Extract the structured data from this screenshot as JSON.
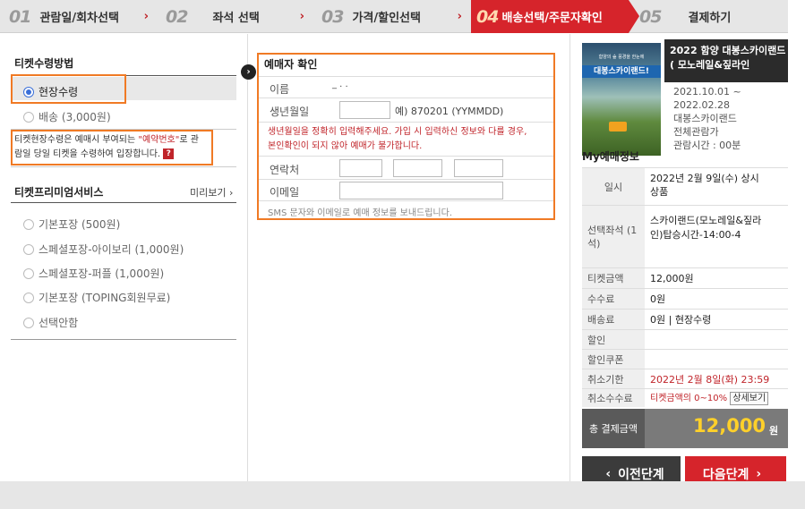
{
  "steps": [
    {
      "num": "01",
      "label": "관람일/회차선택",
      "arrow": "›"
    },
    {
      "num": "02",
      "label": "좌석 선택",
      "arrow": "›"
    },
    {
      "num": "03",
      "label": "가격/할인선택",
      "arrow": "›"
    },
    {
      "num": "04",
      "label": "배송선택/주문자확인",
      "arrow": "›"
    },
    {
      "num": "05",
      "label": "결제하기",
      "arrow": ""
    }
  ],
  "ticket_method": {
    "title": "티켓수령방법",
    "options": [
      {
        "label": "현장수령",
        "selected": true
      },
      {
        "label": "배송 (3,000원)",
        "selected": false
      }
    ],
    "notice_pre": "티켓현장수령은 예매시 부여되는 ",
    "notice_red": "\"예약번호\"",
    "notice_post": "로 관람일 당일 티켓을 수령하여 입장합니다.",
    "help_icon": "?"
  },
  "premium": {
    "title": "티켓프리미엄서비스",
    "preview": "미리보기 ›",
    "options": [
      "기본포장 (500원)",
      "스페셜포장-아이보리 (1,000원)",
      "스페셜포장-퍼플 (1,000원)",
      "기본포장 (TOPING회원무료)",
      "선택안함"
    ]
  },
  "booker": {
    "title": "예매자 확인",
    "name_label": "이름",
    "name_value": "_ . .",
    "birth_label": "생년월일",
    "birth_hint": "예) 870201 (YYMMDD)",
    "warning_line1": "생년월일을 정확히 입력해주세요. 가입 시 입력하신 정보와 다를 경우,",
    "warning_line2": "본인확인이 되지 않아 예매가 불가합니다.",
    "phone_label": "연락처",
    "email_label": "이메일",
    "sms_note": "SMS 문자와 이메일로 예매 정보를 보내드립니다."
  },
  "product": {
    "title": "2022 함양 대봉스카이랜드 ( 모노레일&짚라인",
    "poster_title": "대봉스카이랜드!",
    "poster_sub": "함양의 숲 풍경을 한눈에",
    "period_start": "2021.10.01 ~",
    "period_end": "2022.02.28",
    "venue": "대봉스카이랜드",
    "rating": "전체관람가",
    "runtime": "관람시간 : 00분"
  },
  "my_booking": {
    "title": "My예매정보",
    "rows": [
      {
        "key": "일시",
        "value1": "2022년 2월 9일(수) 상시",
        "value2": "상품"
      },
      {
        "key": "선택좌석 (1석)",
        "value1": "스카이랜드(모노레일&짚라",
        "value2": "인)탑승시간-14:00-4"
      },
      {
        "key": "티켓금액",
        "value1": "12,000원"
      },
      {
        "key": "수수료",
        "value1": "0원"
      },
      {
        "key": "배송료",
        "value1": "0원 | 현장수령"
      },
      {
        "key": "할인",
        "value1": ""
      },
      {
        "key": "할인쿠폰",
        "value1": ""
      },
      {
        "key": "취소기한",
        "value1": "2022년 2월 8일(화) 23:59"
      },
      {
        "key": "취소수수료",
        "value1": "티켓금액의 0~10%",
        "button": "상세보기"
      }
    ],
    "total_label": "총 결제금액",
    "total_amount": "12,000",
    "total_unit": "원"
  },
  "buttons": {
    "prev": "이전단계",
    "next": "다음단계",
    "prev_chev": "‹",
    "next_chev": "›"
  },
  "colors": {
    "accent": "#d6242b",
    "highlight": "#f07a25",
    "amount": "#ffd02a"
  }
}
